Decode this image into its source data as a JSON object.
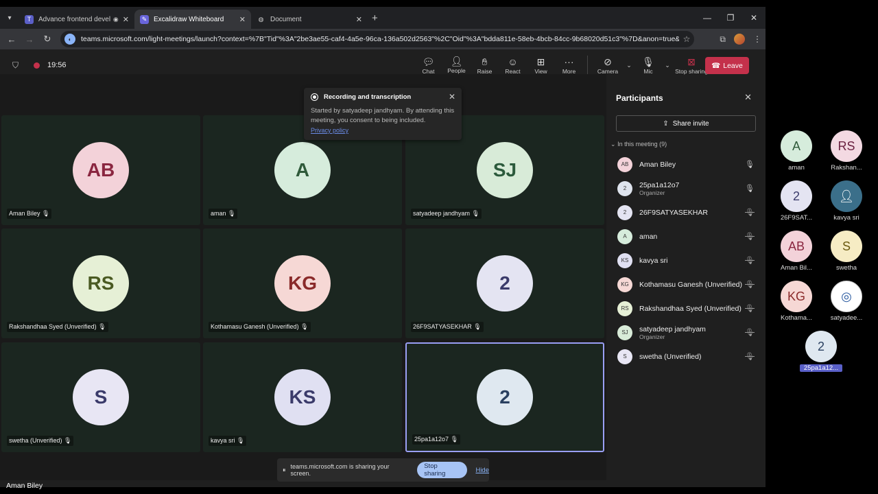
{
  "browser": {
    "tabs": [
      {
        "title": "Advance frontend develop",
        "icon": "teams-icon",
        "active": false
      },
      {
        "title": "Excalidraw Whiteboard",
        "icon": "excalidraw-icon",
        "active": true
      },
      {
        "title": "Document",
        "icon": "globe-icon",
        "active": false
      }
    ],
    "url": "teams.microsoft.com/light-meetings/launch?context=%7B\"Tid\"%3A\"2be3ae55-caf4-4a5e-96ca-136a502d2563\"%2C\"Oid\"%3A\"bdda811e-58eb-4bcb-84cc-9b68020d51c3\"%7D&anon=true&lig..."
  },
  "meeting": {
    "timer": "19:56",
    "buttons": [
      "Chat",
      "People",
      "Raise",
      "React",
      "View",
      "More",
      "Camera",
      "Mic",
      "Stop sharing"
    ],
    "leave_label": "Leave"
  },
  "toast": {
    "title": "Recording and transcription",
    "body": "Started by satyadeep jandhyam. By attending this meeting, you consent to being included.",
    "link": "Privacy policy"
  },
  "tiles": [
    {
      "initials": "AB",
      "name": "Aman Biley",
      "bg": "#f3d2d9",
      "fg": "#8a2640"
    },
    {
      "initials": "A",
      "name": "aman",
      "bg": "#d6ecdc",
      "fg": "#2f5a3a"
    },
    {
      "initials": "SJ",
      "name": "satyadeep jandhyam",
      "bg": "#d8ebd8",
      "fg": "#2c5a3c"
    },
    {
      "initials": "RS",
      "name": "Rakshandhaa Syed (Unverified)",
      "bg": "#e6f0d6",
      "fg": "#4a5a22"
    },
    {
      "initials": "KG",
      "name": "Kothamasu Ganesh (Unverified)",
      "bg": "#f6d8d5",
      "fg": "#8a2a2a"
    },
    {
      "initials": "2",
      "name": "26F9SATYASEKHAR",
      "bg": "#e4e4f2",
      "fg": "#3a3a6a"
    },
    {
      "initials": "S",
      "name": "swetha (Unverified)",
      "bg": "#e8e6f4",
      "fg": "#3a3a6a"
    },
    {
      "initials": "KS",
      "name": "kavya sri",
      "bg": "#e0e0f2",
      "fg": "#3a3a6a"
    },
    {
      "initials": "2",
      "name": "25pa1a12o7",
      "bg": "#dfe8f0",
      "fg": "#2a4060"
    }
  ],
  "panel": {
    "title": "Participants",
    "share_invite": "Share invite",
    "in_meeting": "In this meeting (9)",
    "people": [
      {
        "initials": "AB",
        "name": "Aman Biley",
        "role": "",
        "bg": "#f3d2d9",
        "mic": "on"
      },
      {
        "initials": "2",
        "name": "25pa1a12o7",
        "role": "Organizer",
        "bg": "#dfe4ee",
        "mic": "on"
      },
      {
        "initials": "2",
        "name": "26F9SATYASEKHAR",
        "role": "",
        "bg": "#e4e4f2",
        "mic": "off"
      },
      {
        "initials": "A",
        "name": "aman",
        "role": "",
        "bg": "#d6ecdc",
        "mic": "off"
      },
      {
        "initials": "KS",
        "name": "kavya sri",
        "role": "",
        "bg": "#e0e0f2",
        "mic": "off"
      },
      {
        "initials": "KG",
        "name": "Kothamasu Ganesh (Unverified)",
        "role": "",
        "bg": "#f6d8d5",
        "mic": "off"
      },
      {
        "initials": "RS",
        "name": "Rakshandhaa Syed (Unverified)",
        "role": "",
        "bg": "#e6f0d6",
        "mic": "off"
      },
      {
        "initials": "SJ",
        "name": "satyadeep jandhyam",
        "role": "Organizer",
        "bg": "#d8ebd8",
        "mic": "off"
      },
      {
        "initials": "S",
        "name": "swetha (Unverified)",
        "role": "",
        "bg": "#e8e6f4",
        "mic": "off"
      }
    ]
  },
  "share_bar": {
    "text": "teams.microsoft.com is sharing your screen.",
    "stop": "Stop sharing",
    "hide": "Hide"
  },
  "caption": "Aman Biley",
  "filmstrip": [
    {
      "initials": "A",
      "label": "aman",
      "bg": "#d6ecdc",
      "fg": "#2f5a3a"
    },
    {
      "initials": "RS",
      "label": "Rakshan...",
      "bg": "#f3d9e2",
      "fg": "#6a2040"
    },
    {
      "initials": "2",
      "label": "26F9SAT...",
      "bg": "#e4e4f2",
      "fg": "#3a3a6a"
    },
    {
      "initials": "",
      "label": "kavya sri",
      "bg": "#3b6f8a",
      "fg": "#fff"
    },
    {
      "initials": "AB",
      "label": "Aman Bil...",
      "bg": "#f3d2d9",
      "fg": "#8a2640"
    },
    {
      "initials": "S",
      "label": "swetha",
      "bg": "#f6ecc4",
      "fg": "#6a5a10"
    },
    {
      "initials": "KG",
      "label": "Kothama...",
      "bg": "#f6d8d5",
      "fg": "#8a2a2a"
    },
    {
      "initials": "",
      "label": "satyadee...",
      "bg": "#ffffff",
      "fg": "#2a5aa0"
    },
    {
      "initials": "2",
      "label": "25pa1a12...",
      "bg": "#dfe8f0",
      "fg": "#2a4060"
    }
  ]
}
